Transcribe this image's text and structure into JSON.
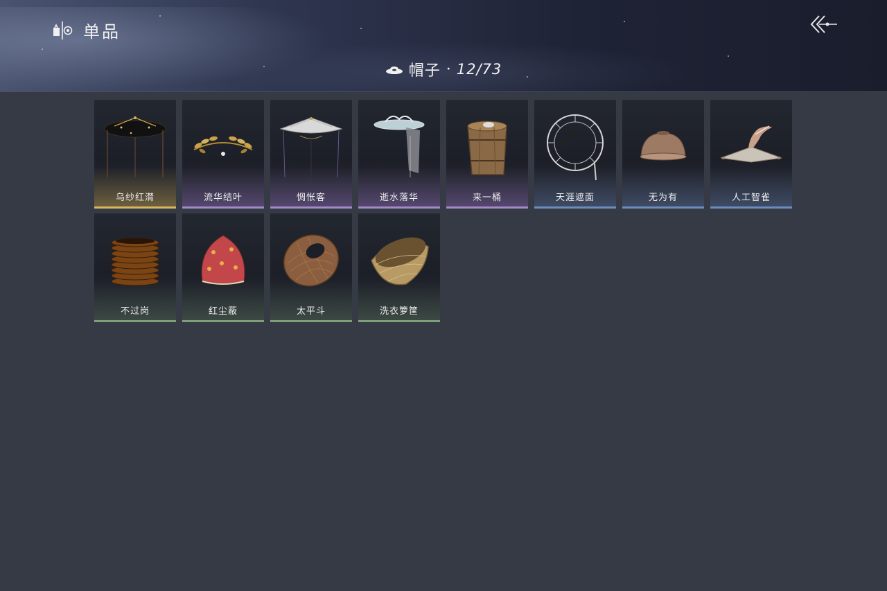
{
  "header": {
    "title": "单品",
    "category": {
      "label": "帽子",
      "separator": "·",
      "count": "12/73"
    }
  },
  "items": [
    {
      "name": "乌纱红潸",
      "rarity": "gold",
      "icon": "black-gauze-hat-icon"
    },
    {
      "name": "流华结叶",
      "rarity": "purple",
      "icon": "golden-leaf-crown-icon"
    },
    {
      "name": "惆怅客",
      "rarity": "purple",
      "icon": "white-veil-hat-icon"
    },
    {
      "name": "逝水落华",
      "rarity": "purple",
      "icon": "silver-veil-headpiece-icon"
    },
    {
      "name": "来一桶",
      "rarity": "purple",
      "icon": "wooden-bucket-hat-icon"
    },
    {
      "name": "天涯遮面",
      "rarity": "blue",
      "icon": "wire-frame-hat-icon"
    },
    {
      "name": "无为有",
      "rarity": "blue",
      "icon": "bowl-hat-icon"
    },
    {
      "name": "人工智雀",
      "rarity": "blue",
      "icon": "bird-hat-icon"
    },
    {
      "name": "不过岗",
      "rarity": "green",
      "icon": "stacked-bowls-hat-icon"
    },
    {
      "name": "红尘蔽",
      "rarity": "green",
      "icon": "red-cloth-hood-icon"
    },
    {
      "name": "太平斗",
      "rarity": "green",
      "icon": "woven-basket-hat-icon"
    },
    {
      "name": "洗衣箩筐",
      "rarity": "green",
      "icon": "laundry-basket-hat-icon"
    }
  ],
  "colors": {
    "gold": "#d9b75e",
    "purple": "#a48ac8",
    "blue": "#6e8dbf",
    "green": "#7fa07a"
  }
}
